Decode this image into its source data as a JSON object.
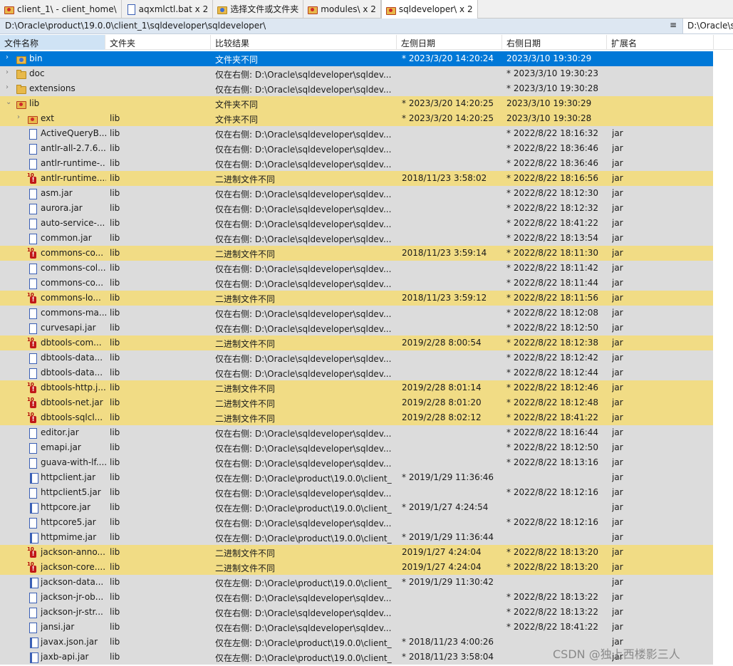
{
  "tabs": [
    {
      "label": "client_1\\ - client_home\\"
    },
    {
      "label": "aqxmlctl.bat x 2"
    },
    {
      "label": "选择文件或文件夹"
    },
    {
      "label": "modules\\ x 2"
    },
    {
      "label": "sqldeveloper\\ x 2"
    }
  ],
  "path": {
    "left": "D:\\Oracle\\product\\19.0.0\\client_1\\sqldeveloper\\sqldeveloper\\",
    "menu": "≡",
    "right": "D:\\Oracle\\sqldeveloper\\sqldeveloper\\"
  },
  "columns": {
    "name": "文件名称",
    "folder": "文件夹",
    "result": "比较结果",
    "left_date": "左侧日期",
    "right_date": "右侧日期",
    "ext": "扩展名"
  },
  "rows": [
    {
      "name": "bin",
      "folder": "",
      "result": "文件夹不同",
      "left": "* 2023/3/20 14:20:24",
      "right": "2023/3/10 19:30:29",
      "ext": "",
      "status": "selected",
      "icon": "folder-blue-icon",
      "indent": 0,
      "expander": "›"
    },
    {
      "name": "doc",
      "folder": "",
      "result": "仅在右侧: D:\\Oracle\\sqldeveloper\\sqldev...",
      "left": "",
      "right": "* 2023/3/10 19:30:23",
      "ext": "",
      "status": "plain",
      "icon": "folder-icon",
      "indent": 0,
      "expander": "›"
    },
    {
      "name": "extensions",
      "folder": "",
      "result": "仅在右侧: D:\\Oracle\\sqldeveloper\\sqldev...",
      "left": "",
      "right": "* 2023/3/10 19:30:28",
      "ext": "",
      "status": "plain",
      "icon": "folder-icon",
      "indent": 0,
      "expander": "›"
    },
    {
      "name": "lib",
      "folder": "",
      "result": "文件夹不同",
      "left": "* 2023/3/20 14:20:25",
      "right": "2023/3/10 19:30:29",
      "ext": "",
      "status": "diff",
      "icon": "folder-red-icon",
      "indent": 0,
      "expander": "⌄"
    },
    {
      "name": "ext",
      "folder": "lib",
      "result": "文件夹不同",
      "left": "* 2023/3/20 14:20:25",
      "right": "2023/3/10 19:30:28",
      "ext": "",
      "status": "diff",
      "icon": "folder-red-icon",
      "indent": 1,
      "expander": "›"
    },
    {
      "name": "ActiveQueryB...",
      "folder": "lib",
      "result": "仅在右侧: D:\\Oracle\\sqldeveloper\\sqldev...",
      "left": "",
      "right": "* 2022/8/22 18:16:32",
      "ext": "jar",
      "status": "plain",
      "icon": "file-icon",
      "indent": 1,
      "expander": ""
    },
    {
      "name": "antlr-all-2.7.6....",
      "folder": "lib",
      "result": "仅在右侧: D:\\Oracle\\sqldeveloper\\sqldev...",
      "left": "",
      "right": "* 2022/8/22 18:36:46",
      "ext": "jar",
      "status": "plain",
      "icon": "file-icon",
      "indent": 1,
      "expander": ""
    },
    {
      "name": "antlr-runtime-...",
      "folder": "lib",
      "result": "仅在右侧: D:\\Oracle\\sqldeveloper\\sqldev...",
      "left": "",
      "right": "* 2022/8/22 18:36:46",
      "ext": "jar",
      "status": "plain",
      "icon": "file-icon",
      "indent": 1,
      "expander": ""
    },
    {
      "name": "antlr-runtime....",
      "folder": "lib",
      "result": "二进制文件不同",
      "left": "2018/11/23 3:58:02",
      "right": "* 2022/8/22 18:16:56",
      "ext": "jar",
      "status": "diff",
      "icon": "binary-diff-icon",
      "indent": 1,
      "expander": ""
    },
    {
      "name": "asm.jar",
      "folder": "lib",
      "result": "仅在右侧: D:\\Oracle\\sqldeveloper\\sqldev...",
      "left": "",
      "right": "* 2022/8/22 18:12:30",
      "ext": "jar",
      "status": "plain",
      "icon": "file-icon",
      "indent": 1,
      "expander": ""
    },
    {
      "name": "aurora.jar",
      "folder": "lib",
      "result": "仅在右侧: D:\\Oracle\\sqldeveloper\\sqldev...",
      "left": "",
      "right": "* 2022/8/22 18:12:32",
      "ext": "jar",
      "status": "plain",
      "icon": "file-icon",
      "indent": 1,
      "expander": ""
    },
    {
      "name": "auto-service-...",
      "folder": "lib",
      "result": "仅在右侧: D:\\Oracle\\sqldeveloper\\sqldev...",
      "left": "",
      "right": "* 2022/8/22 18:41:22",
      "ext": "jar",
      "status": "plain",
      "icon": "file-icon",
      "indent": 1,
      "expander": ""
    },
    {
      "name": "common.jar",
      "folder": "lib",
      "result": "仅在右侧: D:\\Oracle\\sqldeveloper\\sqldev...",
      "left": "",
      "right": "* 2022/8/22 18:13:54",
      "ext": "jar",
      "status": "plain",
      "icon": "file-icon",
      "indent": 1,
      "expander": ""
    },
    {
      "name": "commons-co...",
      "folder": "lib",
      "result": "二进制文件不同",
      "left": "2018/11/23 3:59:14",
      "right": "* 2022/8/22 18:11:30",
      "ext": "jar",
      "status": "diff",
      "icon": "binary-diff-icon",
      "indent": 1,
      "expander": ""
    },
    {
      "name": "commons-col...",
      "folder": "lib",
      "result": "仅在右侧: D:\\Oracle\\sqldeveloper\\sqldev...",
      "left": "",
      "right": "* 2022/8/22 18:11:42",
      "ext": "jar",
      "status": "plain",
      "icon": "file-icon",
      "indent": 1,
      "expander": ""
    },
    {
      "name": "commons-co...",
      "folder": "lib",
      "result": "仅在右侧: D:\\Oracle\\sqldeveloper\\sqldev...",
      "left": "",
      "right": "* 2022/8/22 18:11:44",
      "ext": "jar",
      "status": "plain",
      "icon": "file-icon",
      "indent": 1,
      "expander": ""
    },
    {
      "name": "commons-lo...",
      "folder": "lib",
      "result": "二进制文件不同",
      "left": "2018/11/23 3:59:12",
      "right": "* 2022/8/22 18:11:56",
      "ext": "jar",
      "status": "diff",
      "icon": "binary-diff-icon",
      "indent": 1,
      "expander": ""
    },
    {
      "name": "commons-ma...",
      "folder": "lib",
      "result": "仅在右侧: D:\\Oracle\\sqldeveloper\\sqldev...",
      "left": "",
      "right": "* 2022/8/22 18:12:08",
      "ext": "jar",
      "status": "plain",
      "icon": "file-icon",
      "indent": 1,
      "expander": ""
    },
    {
      "name": "curvesapi.jar",
      "folder": "lib",
      "result": "仅在右侧: D:\\Oracle\\sqldeveloper\\sqldev...",
      "left": "",
      "right": "* 2022/8/22 18:12:50",
      "ext": "jar",
      "status": "plain",
      "icon": "file-icon",
      "indent": 1,
      "expander": ""
    },
    {
      "name": "dbtools-com...",
      "folder": "lib",
      "result": "二进制文件不同",
      "left": "2019/2/28 8:00:54",
      "right": "* 2022/8/22 18:12:38",
      "ext": "jar",
      "status": "diff",
      "icon": "binary-diff-icon",
      "indent": 1,
      "expander": ""
    },
    {
      "name": "dbtools-data...",
      "folder": "lib",
      "result": "仅在右侧: D:\\Oracle\\sqldeveloper\\sqldev...",
      "left": "",
      "right": "* 2022/8/22 18:12:42",
      "ext": "jar",
      "status": "plain",
      "icon": "file-icon",
      "indent": 1,
      "expander": ""
    },
    {
      "name": "dbtools-data...",
      "folder": "lib",
      "result": "仅在右侧: D:\\Oracle\\sqldeveloper\\sqldev...",
      "left": "",
      "right": "* 2022/8/22 18:12:44",
      "ext": "jar",
      "status": "plain",
      "icon": "file-icon",
      "indent": 1,
      "expander": ""
    },
    {
      "name": "dbtools-http.j...",
      "folder": "lib",
      "result": "二进制文件不同",
      "left": "2019/2/28 8:01:14",
      "right": "* 2022/8/22 18:12:46",
      "ext": "jar",
      "status": "diff",
      "icon": "binary-diff-icon",
      "indent": 1,
      "expander": ""
    },
    {
      "name": "dbtools-net.jar",
      "folder": "lib",
      "result": "二进制文件不同",
      "left": "2019/2/28 8:01:20",
      "right": "* 2022/8/22 18:12:48",
      "ext": "jar",
      "status": "diff",
      "icon": "binary-diff-icon",
      "indent": 1,
      "expander": ""
    },
    {
      "name": "dbtools-sqlcl...",
      "folder": "lib",
      "result": "二进制文件不同",
      "left": "2019/2/28 8:02:12",
      "right": "* 2022/8/22 18:41:22",
      "ext": "jar",
      "status": "diff",
      "icon": "binary-diff-icon",
      "indent": 1,
      "expander": ""
    },
    {
      "name": "editor.jar",
      "folder": "lib",
      "result": "仅在右侧: D:\\Oracle\\sqldeveloper\\sqldev...",
      "left": "",
      "right": "* 2022/8/22 18:16:44",
      "ext": "jar",
      "status": "plain",
      "icon": "file-icon",
      "indent": 1,
      "expander": ""
    },
    {
      "name": "emapi.jar",
      "folder": "lib",
      "result": "仅在右侧: D:\\Oracle\\sqldeveloper\\sqldev...",
      "left": "",
      "right": "* 2022/8/22 18:12:50",
      "ext": "jar",
      "status": "plain",
      "icon": "file-icon",
      "indent": 1,
      "expander": ""
    },
    {
      "name": "guava-with-lf....",
      "folder": "lib",
      "result": "仅在右侧: D:\\Oracle\\sqldeveloper\\sqldev...",
      "left": "",
      "right": "* 2022/8/22 18:13:16",
      "ext": "jar",
      "status": "plain",
      "icon": "file-icon",
      "indent": 1,
      "expander": ""
    },
    {
      "name": "httpclient.jar",
      "folder": "lib",
      "result": "仅在左侧: D:\\Oracle\\product\\19.0.0\\client_...",
      "left": "* 2019/1/29 11:36:46",
      "right": "",
      "ext": "jar",
      "status": "plain",
      "icon": "file-left-icon",
      "indent": 1,
      "expander": ""
    },
    {
      "name": "httpclient5.jar",
      "folder": "lib",
      "result": "仅在右侧: D:\\Oracle\\sqldeveloper\\sqldev...",
      "left": "",
      "right": "* 2022/8/22 18:12:16",
      "ext": "jar",
      "status": "plain",
      "icon": "file-icon",
      "indent": 1,
      "expander": ""
    },
    {
      "name": "httpcore.jar",
      "folder": "lib",
      "result": "仅在左侧: D:\\Oracle\\product\\19.0.0\\client_...",
      "left": "* 2019/1/27 4:24:54",
      "right": "",
      "ext": "jar",
      "status": "plain",
      "icon": "file-left-icon",
      "indent": 1,
      "expander": ""
    },
    {
      "name": "httpcore5.jar",
      "folder": "lib",
      "result": "仅在右侧: D:\\Oracle\\sqldeveloper\\sqldev...",
      "left": "",
      "right": "* 2022/8/22 18:12:16",
      "ext": "jar",
      "status": "plain",
      "icon": "file-icon",
      "indent": 1,
      "expander": ""
    },
    {
      "name": "httpmime.jar",
      "folder": "lib",
      "result": "仅在左侧: D:\\Oracle\\product\\19.0.0\\client_...",
      "left": "* 2019/1/29 11:36:44",
      "right": "",
      "ext": "jar",
      "status": "plain",
      "icon": "file-left-icon",
      "indent": 1,
      "expander": ""
    },
    {
      "name": "jackson-anno...",
      "folder": "lib",
      "result": "二进制文件不同",
      "left": "2019/1/27 4:24:04",
      "right": "* 2022/8/22 18:13:20",
      "ext": "jar",
      "status": "diff",
      "icon": "binary-diff-icon",
      "indent": 1,
      "expander": ""
    },
    {
      "name": "jackson-core....",
      "folder": "lib",
      "result": "二进制文件不同",
      "left": "2019/1/27 4:24:04",
      "right": "* 2022/8/22 18:13:20",
      "ext": "jar",
      "status": "diff",
      "icon": "binary-diff-icon",
      "indent": 1,
      "expander": ""
    },
    {
      "name": "jackson-data...",
      "folder": "lib",
      "result": "仅在左侧: D:\\Oracle\\product\\19.0.0\\client_...",
      "left": "* 2019/1/29 11:30:42",
      "right": "",
      "ext": "jar",
      "status": "plain",
      "icon": "file-left-icon",
      "indent": 1,
      "expander": ""
    },
    {
      "name": "jackson-jr-ob...",
      "folder": "lib",
      "result": "仅在右侧: D:\\Oracle\\sqldeveloper\\sqldev...",
      "left": "",
      "right": "* 2022/8/22 18:13:22",
      "ext": "jar",
      "status": "plain",
      "icon": "file-icon",
      "indent": 1,
      "expander": ""
    },
    {
      "name": "jackson-jr-str...",
      "folder": "lib",
      "result": "仅在右侧: D:\\Oracle\\sqldeveloper\\sqldev...",
      "left": "",
      "right": "* 2022/8/22 18:13:22",
      "ext": "jar",
      "status": "plain",
      "icon": "file-icon",
      "indent": 1,
      "expander": ""
    },
    {
      "name": "jansi.jar",
      "folder": "lib",
      "result": "仅在右侧: D:\\Oracle\\sqldeveloper\\sqldev...",
      "left": "",
      "right": "* 2022/8/22 18:41:22",
      "ext": "jar",
      "status": "plain",
      "icon": "file-icon",
      "indent": 1,
      "expander": ""
    },
    {
      "name": "javax.json.jar",
      "folder": "lib",
      "result": "仅在左侧: D:\\Oracle\\product\\19.0.0\\client_...",
      "left": "* 2018/11/23 4:00:26",
      "right": "",
      "ext": "jar",
      "status": "plain",
      "icon": "file-left-icon",
      "indent": 1,
      "expander": ""
    },
    {
      "name": "jaxb-api.jar",
      "folder": "lib",
      "result": "仅在左侧: D:\\Oracle\\product\\19.0.0\\client_...",
      "left": "* 2018/11/23 3:58:04",
      "right": "",
      "ext": "jar",
      "status": "plain",
      "icon": "file-left-icon",
      "indent": 1,
      "expander": ""
    }
  ],
  "watermark": "CSDN @独上西楼影三人"
}
